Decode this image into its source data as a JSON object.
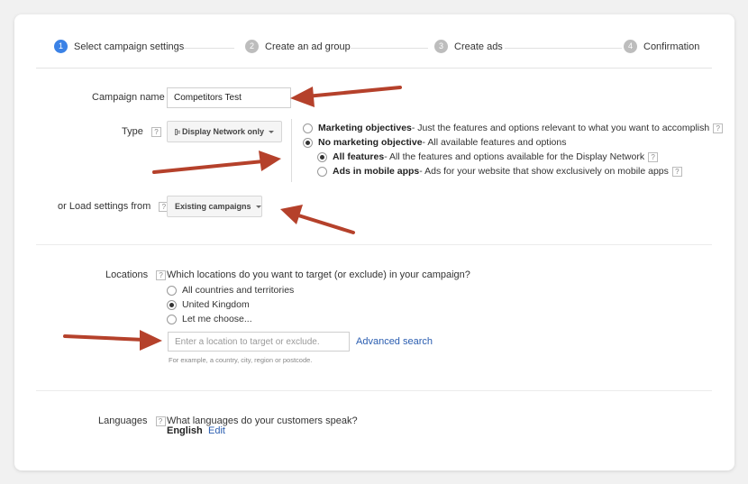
{
  "steps": [
    {
      "num": "1",
      "label": "Select campaign settings"
    },
    {
      "num": "2",
      "label": "Create an ad group"
    },
    {
      "num": "3",
      "label": "Create ads"
    },
    {
      "num": "4",
      "label": "Confirmation"
    }
  ],
  "campaign": {
    "name_label": "Campaign name",
    "name_value": "Competitors Test"
  },
  "type": {
    "label": "Type",
    "help": "?",
    "dropdown_label": "Display Network only",
    "options": [
      {
        "title": "Marketing objectives",
        "desc": " - Just the features and options relevant to what you want to accomplish"
      },
      {
        "title": "No marketing objective",
        "desc": " - All available features and options"
      },
      {
        "title": "All features",
        "desc": " - All the features and options available for the Display Network"
      },
      {
        "title": "Ads in mobile apps",
        "desc": " - Ads for your website that show exclusively on mobile apps"
      }
    ]
  },
  "load_settings": {
    "label": "or Load settings from",
    "dropdown_label": "Existing campaigns"
  },
  "locations": {
    "label": "Locations",
    "question": "Which locations do you want to target (or exclude) in your campaign?",
    "options": [
      "All countries and territories",
      "United Kingdom",
      "Let me choose..."
    ],
    "input_placeholder": "Enter a location to target or exclude.",
    "advanced_link": "Advanced search",
    "hint": "For example, a country, city, region or postcode."
  },
  "languages": {
    "label": "Languages",
    "question": "What languages do your customers speak?",
    "value": "English",
    "edit_link": "Edit"
  },
  "colors": {
    "accent": "#3b82e6",
    "link": "#2a5db0",
    "annotation_arrow": "#b5412b"
  }
}
